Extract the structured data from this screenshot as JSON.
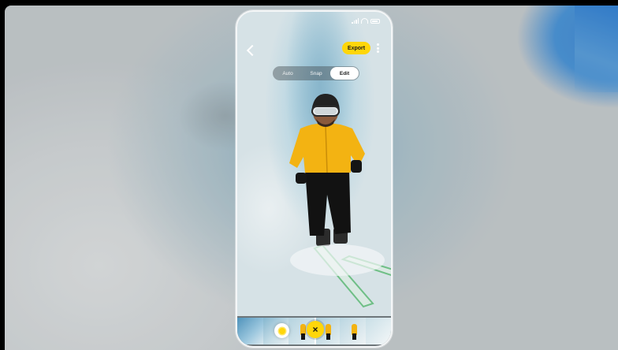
{
  "statusbar": {
    "time": ""
  },
  "topbar": {
    "export_label": "Export"
  },
  "mode_tabs": [
    {
      "label": "Auto"
    },
    {
      "label": "Snap"
    },
    {
      "label": "Edit",
      "active": true
    }
  ],
  "timeline": {
    "cut_icon": "×",
    "marker_icon": "sun-icon"
  },
  "colors": {
    "accent": "#ffd60a",
    "jacket": "#f3b312"
  }
}
